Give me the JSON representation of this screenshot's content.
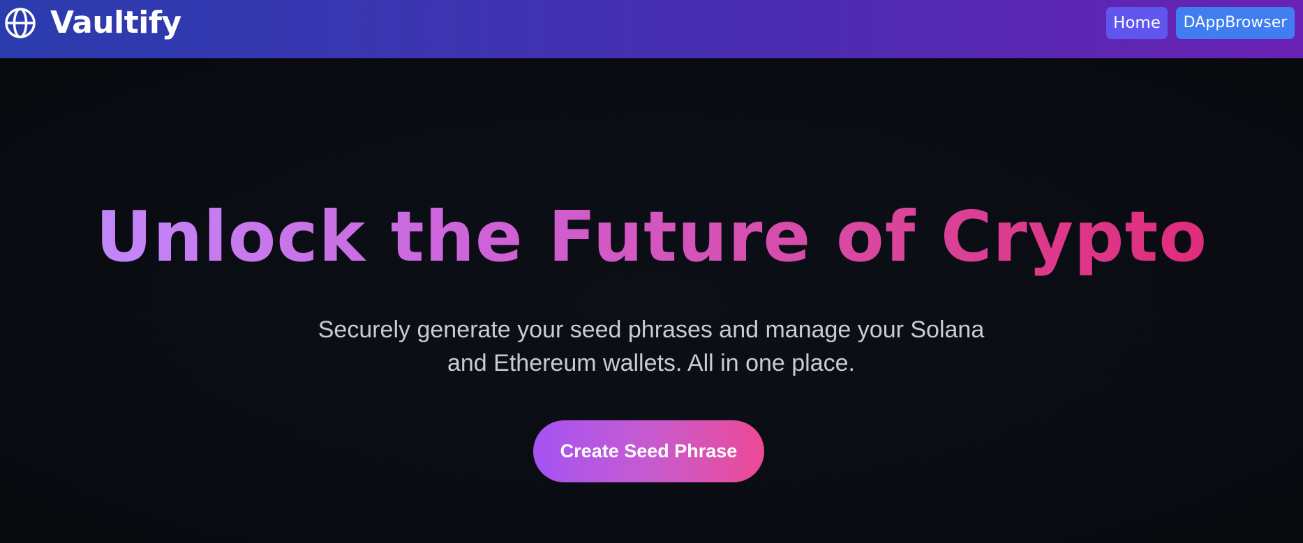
{
  "navbar": {
    "brand_icon": "globe-icon",
    "brand_name": "Vaultify",
    "links": [
      {
        "label": "Home"
      },
      {
        "label": "DAppBrowser"
      }
    ]
  },
  "hero": {
    "headline": "Unlock the Future of Crypto",
    "subtitle_line1": "Securely generate your seed phrases and manage your Solana",
    "subtitle_line2": "and Ethereum wallets. All in one place.",
    "cta_label": "Create Seed Phrase"
  },
  "colors": {
    "navbar_gradient_start": "#2a3cae",
    "navbar_gradient_end": "#6a22b4",
    "background": "#0b0d12",
    "headline_gradient_start": "#c287fa",
    "headline_gradient_end": "#e02c7a",
    "home_button": "#6056ee",
    "dapp_button": "#3f7df0",
    "cta_gradient_start": "#a553f3",
    "cta_gradient_end": "#ec4a94"
  }
}
